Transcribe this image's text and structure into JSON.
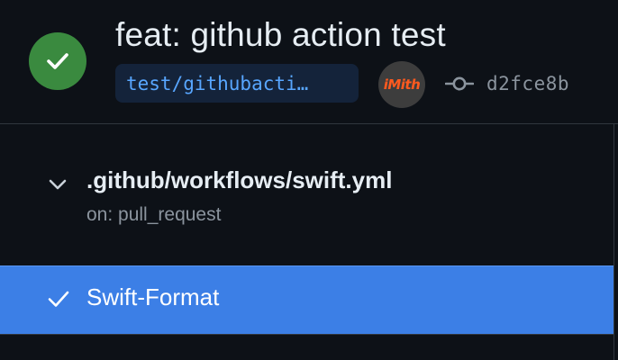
{
  "commit": {
    "title": "feat: github action test",
    "branch": "test/githubacti…",
    "sha": "d2fce8b",
    "status": "success",
    "status_color": "#3a8a3f"
  },
  "author": {
    "avatar_text": "iMith"
  },
  "workflow": {
    "path": ".github/workflows/swift.yml",
    "trigger": "on: pull_request",
    "expanded": true
  },
  "jobs": [
    {
      "label": "Swift-Format",
      "status": "success",
      "selected": true
    }
  ],
  "colors": {
    "background": "#0d1117",
    "accent_selected": "#3c7fe6",
    "branch_text": "#58a6ff",
    "branch_bg": "#14233a",
    "muted_text": "#8b949e"
  },
  "icons": {
    "status": "check-circle-icon",
    "commit": "git-commit-icon",
    "expand": "chevron-down-icon",
    "job_status": "check-icon"
  }
}
